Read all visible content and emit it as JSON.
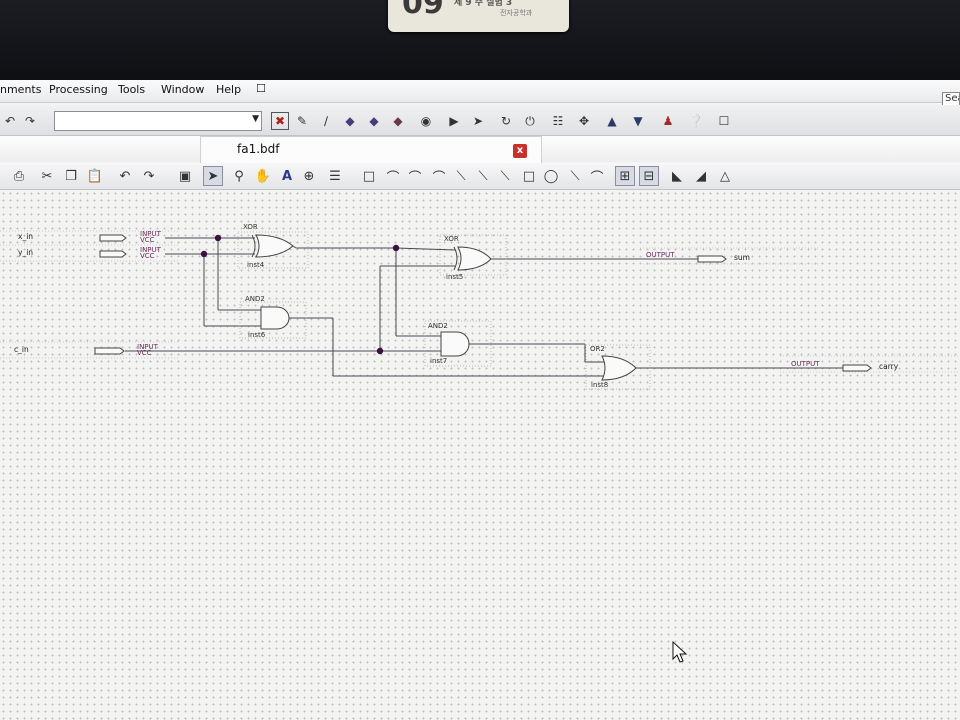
{
  "sticker": {
    "number": "09",
    "text": "제 9 주 실험 3",
    "subtext": "전자공학과"
  },
  "menubar": {
    "items": [
      "nments",
      "Processing",
      "Tools",
      "Window",
      "Help"
    ],
    "search_label": "Sea"
  },
  "document": {
    "tab_title": "fa1.bdf",
    "close_label": "x"
  },
  "toolbar1": {
    "combo_value": "",
    "icons": [
      "undo-icon",
      "redo-icon",
      "chip-planner-icon",
      "pin-icon",
      "wand-icon",
      "compile-icon",
      "compile-analysis-icon",
      "compile-fitter-icon",
      "stop-icon",
      "play-icon",
      "timing-icon",
      "rtl-viewer-icon",
      "power-icon",
      "netlist-icon",
      "programmer-icon",
      "node-finder-icon",
      "chip-editor-icon",
      "person-icon",
      "help-icon",
      "comment-icon"
    ]
  },
  "toolbar2": {
    "icons": [
      "print-icon",
      "cut-icon",
      "copy-icon",
      "paste-icon",
      "undo-icon",
      "redo-icon",
      "block-icon",
      "pointer-icon",
      "zoom-icon",
      "hand-icon",
      "text-icon",
      "symbol-icon",
      "pin-tool-icon",
      "rectangle-icon",
      "orthogonal-node-icon",
      "orthogonal-bus-icon",
      "conduit-icon",
      "diagonal-line-icon",
      "arc-icon",
      "ellipse-icon",
      "line-icon",
      "rubberband-icon",
      "partial-select-icon",
      "flip-icon",
      "rotate-icon",
      "snap-icon"
    ]
  },
  "schematic": {
    "input_pins": [
      {
        "name": "x_in",
        "primitive": "INPUT",
        "value": "VCC"
      },
      {
        "name": "y_in",
        "primitive": "INPUT",
        "value": "VCC"
      },
      {
        "name": "c_in",
        "primitive": "INPUT",
        "value": "VCC"
      }
    ],
    "gates": [
      {
        "type": "XOR",
        "instance": "inst4"
      },
      {
        "type": "AND2",
        "instance": "inst6"
      },
      {
        "type": "XOR",
        "instance": "inst5"
      },
      {
        "type": "AND2",
        "instance": "inst7"
      },
      {
        "type": "OR2",
        "instance": "inst8"
      }
    ],
    "output_pins": [
      {
        "name": "sum",
        "primitive": "OUTPUT"
      },
      {
        "name": "carry",
        "primitive": "OUTPUT"
      }
    ]
  },
  "colors": {
    "wire": "#4a4a55",
    "junction": "#3a1240",
    "primitive_text": "#6b2c62",
    "close_button": "#c9302c"
  }
}
